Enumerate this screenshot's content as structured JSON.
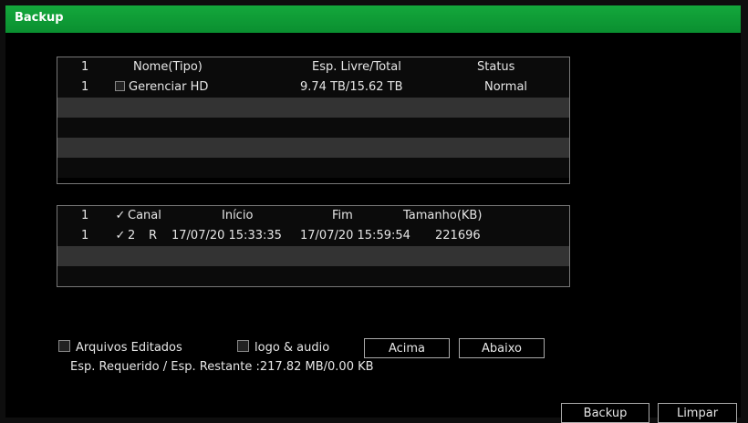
{
  "window": {
    "title": "Backup"
  },
  "devices": {
    "headers": {
      "num": "1",
      "name": "Nome(Tipo)",
      "space": "Esp. Livre/Total",
      "status": "Status"
    },
    "rows": [
      {
        "num": "1",
        "name": "Gerenciar HD",
        "space": "9.74 TB/15.62 TB",
        "status": "Normal",
        "checked": false
      }
    ]
  },
  "files": {
    "headers": {
      "num": "1",
      "channel_check": "✓",
      "channel": "Canal",
      "start": "Início",
      "end": "Fim",
      "size": "Tamanho(KB)"
    },
    "rows": [
      {
        "num": "1",
        "check": "✓",
        "channel": "2",
        "type": "R",
        "start": "17/07/20 15:33:35",
        "end": "17/07/20 15:59:54",
        "size": "221696"
      }
    ]
  },
  "options": {
    "edited_files_label": "Arquivos Editados",
    "logo_audio_label": "logo & audio",
    "up_label": "Acima",
    "down_label": "Abaixo"
  },
  "space_info": "Esp. Requerido / Esp. Restante :217.82 MB/0.00 KB",
  "actions": {
    "backup_label": "Backup",
    "clear_label": "Limpar"
  },
  "colors": {
    "title_bar": "#0a8f30",
    "row_alt": "#333333"
  }
}
